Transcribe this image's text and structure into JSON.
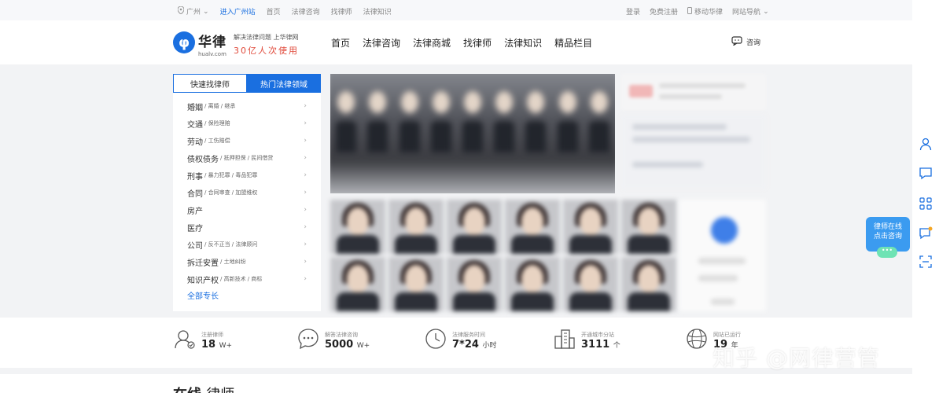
{
  "topbar": {
    "city": "广州",
    "links": [
      "进入广州站",
      "首页",
      "法律咨询",
      "找律师",
      "法律知识"
    ],
    "right_links": [
      "登录",
      "免费注册",
      "移动华律",
      "网站导航"
    ]
  },
  "header": {
    "logo_glyph": "φ",
    "brand_name": "华律",
    "brand_domain": "hualv.com",
    "slogan_line1": "解决法律问题 上华律网",
    "slogan_line2": "30亿人次使用",
    "nav": [
      "首页",
      "法律咨询",
      "法律商城",
      "找律师",
      "法律知识",
      "精品栏目"
    ],
    "consult_label": "咨询"
  },
  "left_panel": {
    "tabs": [
      "快速找律师",
      "热门法律领域"
    ],
    "categories": [
      {
        "main": "婚姻",
        "sub": "/ 离婚 / 继承"
      },
      {
        "main": "交通",
        "sub": "/ 保险理赔"
      },
      {
        "main": "劳动",
        "sub": "/ 工伤赔偿"
      },
      {
        "main": "债权债务",
        "sub": "/ 抵押担保 / 民间借贷"
      },
      {
        "main": "刑事",
        "sub": "/ 暴力犯罪 / 毒品犯罪"
      },
      {
        "main": "合同",
        "sub": "/ 合同审查 / 加盟维权"
      },
      {
        "main": "房产",
        "sub": ""
      },
      {
        "main": "医疗",
        "sub": ""
      },
      {
        "main": "公司",
        "sub": "/ 反不正当 / 法律顾问"
      },
      {
        "main": "拆迁安置",
        "sub": "/ 土地纠纷"
      },
      {
        "main": "知识产权",
        "sub": "/ 高新技术 / 商标"
      }
    ],
    "all_label": "全部专长"
  },
  "stats": [
    {
      "label": "注册律师",
      "value": "18",
      "unit": "W+",
      "icon": "lawyer-icon"
    },
    {
      "label": "解答法律咨询",
      "value": "5000",
      "unit": "W+",
      "icon": "chat-icon"
    },
    {
      "label": "法律服务时间",
      "value": "7*24",
      "unit": "小时",
      "icon": "clock-icon"
    },
    {
      "label": "开通城市分站",
      "value": "3111",
      "unit": "个",
      "icon": "city-icon"
    },
    {
      "label": "网站已运行",
      "value": "19",
      "unit": "年",
      "icon": "globe-icon"
    }
  ],
  "bottom": {
    "title_bold": "在线",
    "title_rest": "律师"
  },
  "float_bubble": {
    "line1": "律师在线",
    "line2": "点击咨询",
    "dots": "•••"
  },
  "watermark": "知乎 @网律营管",
  "colors": {
    "accent": "#1a6fe0",
    "slogan": "#e0493a"
  }
}
